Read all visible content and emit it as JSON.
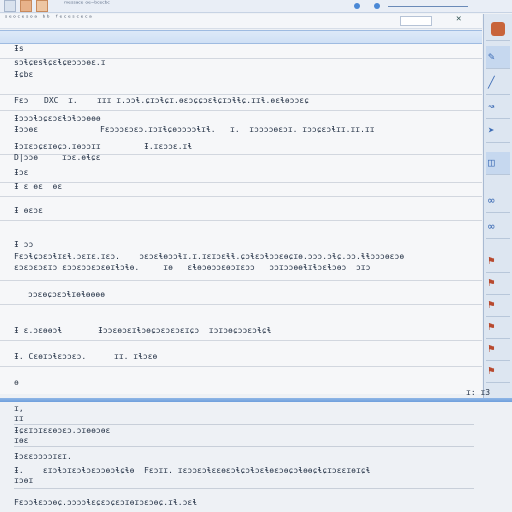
{
  "titlebar": {
    "title": "ᵐᵉˢˢᵃᶜᵉ ᵒᵉ⁻ᵇᶜᵉᶜᵇᶜ"
  },
  "strip": {
    "text": "ˢᵉᵒᶜᵉˢᵒᵃ ᵇᵇ ᶠᵉᶜᵉˢᶜᵉᶜᵃ",
    "close": "✕"
  },
  "rows": {
    "r1": "Ɨs",
    "r2": "sɔɬɕɐsɬɕɛɬɕɐɔɔɔɵɛ.ɪ",
    "r3": "Ɨɕbɛ",
    "r4a": "Fɛɔ",
    "r4b": "DXC  ɪ.    ɪɪɪ ɪ.ɔɔɬ.ɕɪɔɬɕɪ.ɵɛɔɕɕɔɛɬɕɪɔɬɬɕ.ɪɪɬ.ɵɛɬɵɔɔɛɕ",
    "r5a": "Ɨɔɔɔɬɔɕɛɔɛɬɔɬɔɔɵɵɵ",
    "r5b": "Fɛɔɔɔɛɔɛɔ.ɪɔɪɬɕɵɔɔɔɔɬɪɬ.   ɪ.  ɪɔɔɔɔɵɛɔɪ. ɪɔɔɕɛɔɬɪɪ.ɪɪ.ɪɪ",
    "r5c": "Ɨɔɔɵɛ",
    "r6a": "Ɨɔɪɛɔɕɛɪɵɕɔ.ɪɵɔɔɪɪ",
    "r6b": "Ɨ.ɪɛɔɔɛ.ɪɬ",
    "r6c": "D|ɔɔɵ",
    "r6d": "ɪɔɛ.ɵɬɕɛ",
    "r7": "Ɨɔɛ",
    "r8": "Ɨ ɛ ɵɛ  ɵɛ",
    "r9": "Ɨ ɵɛɔɛ",
    "r10": "Ɨ ɔɔ",
    "r11a": "Fɛɔɬɕɔɛɔɬɪɛɬ.ɔɛɪɛ.ɪɛɔ.    ɔɛɔɛɬɵɔɔɬɪ.ɪ.ɪɛɪɔɛɬɬ.ɕɔɬɛɔɬɔɔɛɵɕɪɵ.ɔɔɔ.ɔɬɕ.ɔɔ.ɬɬɔɔɔɵɛɔɵ",
    "r11b": "ɛɔɛɔɛɔɛɪɔ ɛɔɔɛɔɔɛɔɛɵɪɬɔɬɵ.     ɪɵ   ɛɬɵɔɵɔɔɛɵɔɪɛɔɔ   ɔɔɪɔɔɵɵɬɪɬɔɛɬɔɵɔ  ɔɪɔ",
    "r12": "ɔɔɛɵɕɔɛɔɬɪɵɬɵɵɵɵ",
    "r13a": "Ɨ ɛ.ɔɛɵɵɔɬ",
    "r13b": "Ɨɔɔɛɵɔɛɪɬɔɵɕɔɛɔɛɔɛɪɕɔ  ɪɔɪɔɵɕɔɔɛɔɬɕɬ",
    "r14a": "Ɨ. Cɛɵɪɔɬɛɔɔɛɔ.",
    "r14b": "ɪɪ. ɪɬɔɛɵ",
    "r15": "ɵ"
  },
  "pager": "ɪ: ɪ3",
  "lower": {
    "l1": "ɪ,",
    "l2": "ɪɪ",
    "l3": "ɪɵɛ",
    "l4": "Ɨɕɛɪɔɪɛɛɵɔɛɔ.ɔɪɵɵɔɵɛ",
    "l5": "ɪɔɔɛ",
    "l6": "Ɨɔɛɛɔɔɔɔɪɛɪ.",
    "l7": "Ɨ.    ɛɪɔɬɔɪɛɔɬɔɛɔɔɵɔɬɕɬɵ  Fɛɔɪɪ. ɪɛɔɔɛɔɬɛɛɵɛɔɬɕɔɬɔɛɬɵɛɔɵɕɔɬɵɵɕɬɕɪɔɛɛɪɵɪɕɬ",
    "l8": "ɪɔɵɪ",
    "l9": "Fɛɔɔɬɛɔɔɵɕ.ɔɔɔɔɬɛɕɛɔɕɛɔɪɵɪɔɛɔɵɕ.ɪɬ.ɔɛɬ"
  },
  "icons": [
    "arrow-icon",
    "pencil-icon",
    "line-icon",
    "curve-icon",
    "arrow-icon",
    "shape-icon",
    "link-icon",
    "link-icon",
    "flag-icon",
    "flag-icon",
    "flag-icon",
    "flag-icon",
    "flag-icon",
    "flag-icon",
    "flag-icon",
    "flag-icon"
  ],
  "colors": {
    "accent": "#4a88d6",
    "highlight": "#c6d8ef",
    "brand": "#d9733f"
  }
}
